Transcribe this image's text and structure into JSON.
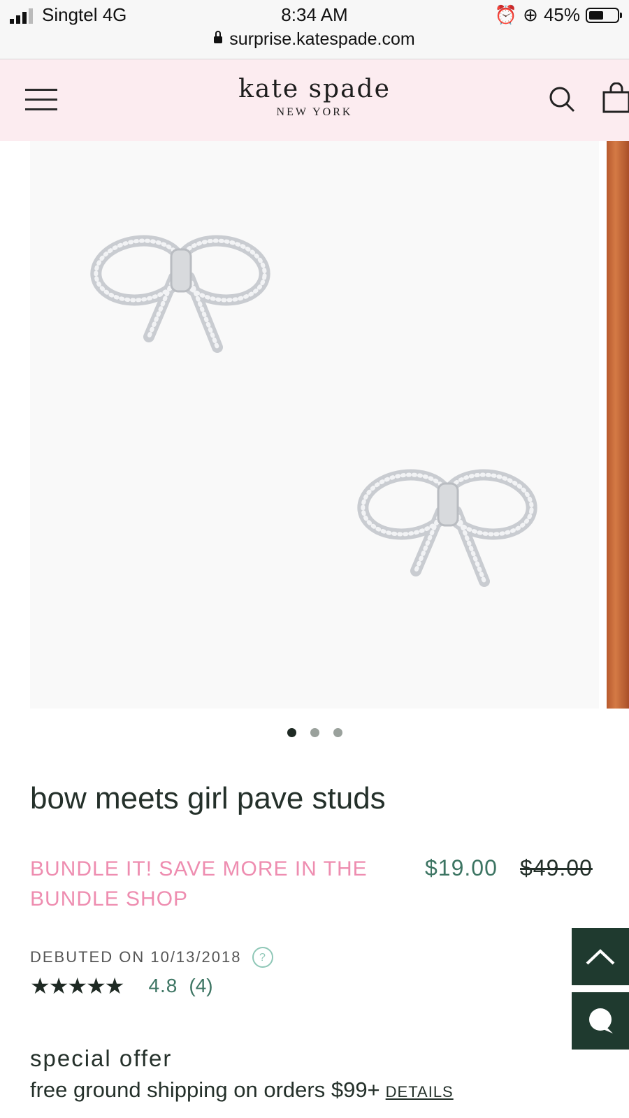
{
  "status_bar": {
    "carrier": "Singtel 4G",
    "time": "8:34 AM",
    "battery": "45%",
    "url": "surprise.katespade.com"
  },
  "header": {
    "brand_name": "kate spade",
    "brand_sub": "NEW YORK",
    "menu_icon": "hamburger-icon",
    "search_icon": "search-icon",
    "bag_icon": "shopping-bag-icon",
    "background": "#fcecf0"
  },
  "carousel": {
    "total": 3,
    "active_index": 0
  },
  "product": {
    "title": "bow meets girl pave studs",
    "promo": "BUNDLE IT! SAVE MORE IN THE BUNDLE SHOP",
    "price": "$19.00",
    "original_price": "$49.00",
    "debut": "DEBUTED ON 10/13/2018",
    "help": "?",
    "rating_value": "4.8",
    "rating_count": "(4)",
    "rating_stars": 4.8
  },
  "offer": {
    "title": "special offer",
    "text": "free ground shipping on orders $99+",
    "details_label": "DETAILS"
  },
  "colors": {
    "accent_green": "#3d7563",
    "promo_pink": "#ee8db0",
    "fab_green": "#1f3a2f"
  }
}
